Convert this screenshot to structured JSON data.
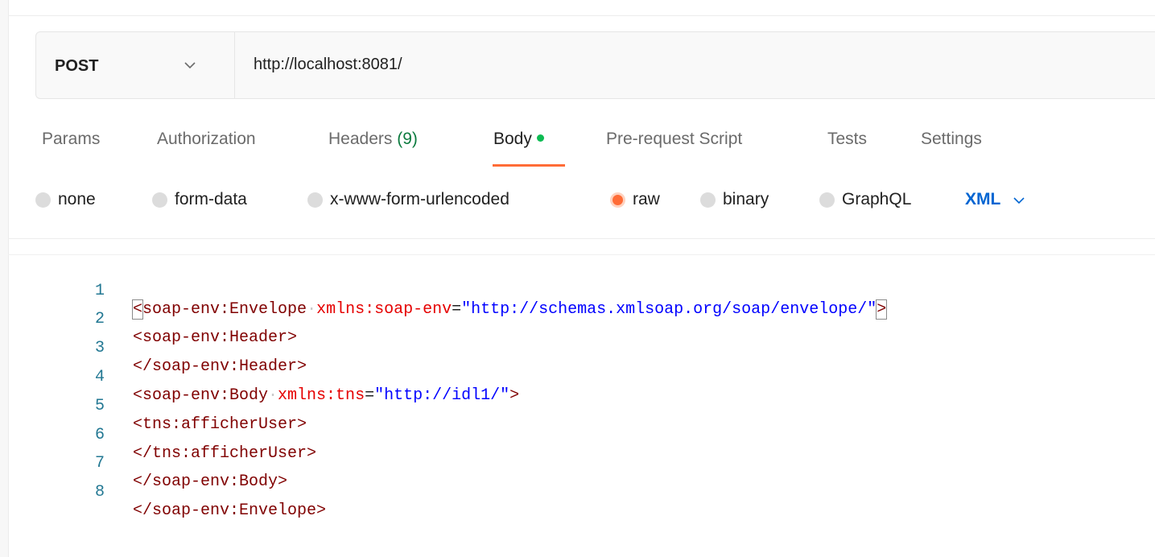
{
  "request": {
    "method": "POST",
    "url": "http://localhost:8081/"
  },
  "tabs": [
    {
      "label": "Params"
    },
    {
      "label": "Authorization"
    },
    {
      "label": "Headers",
      "count": "(9)"
    },
    {
      "label": "Body",
      "active": true,
      "indicator": "green-dot"
    },
    {
      "label": "Pre-request Script"
    },
    {
      "label": "Tests"
    },
    {
      "label": "Settings"
    }
  ],
  "body_types": [
    {
      "label": "none",
      "selected": false
    },
    {
      "label": "form-data",
      "selected": false
    },
    {
      "label": "x-www-form-urlencoded",
      "selected": false
    },
    {
      "label": "raw",
      "selected": true
    },
    {
      "label": "binary",
      "selected": false
    },
    {
      "label": "GraphQL",
      "selected": false
    }
  ],
  "format": {
    "label": "XML"
  },
  "editor": {
    "line_numbers": [
      "1",
      "2",
      "3",
      "4",
      "5",
      "6",
      "7",
      "8"
    ],
    "l1": {
      "open": "<",
      "tag": "soap-env:Envelope",
      "ws": "·",
      "attr": "xmlns:soap-env",
      "eq": "=",
      "value": "\"http://schemas.xmlsoap.org/soap/envelope/\"",
      "close": ">"
    },
    "l2": "<soap-env:Header>",
    "l3": "</soap-env:Header>",
    "l4": {
      "tag": "<soap-env:Body",
      "ws": "·",
      "attr": "xmlns:tns",
      "eq": "=",
      "value": "\"http://idl1/\"",
      "close": ">"
    },
    "l5": "<tns:afficherUser>",
    "l6": "</tns:afficherUser>",
    "l7": "</soap-env:Body>",
    "l8": "</soap-env:Envelope>"
  },
  "colors": {
    "accent": "#ff6c37",
    "active_dot": "#0cbb52",
    "headers_count": "#0c7b3f",
    "format_select": "#0265d2",
    "xml_tag": "#800000",
    "xml_attr": "#e50000",
    "xml_string": "#0000ff",
    "line_number": "#237893"
  }
}
